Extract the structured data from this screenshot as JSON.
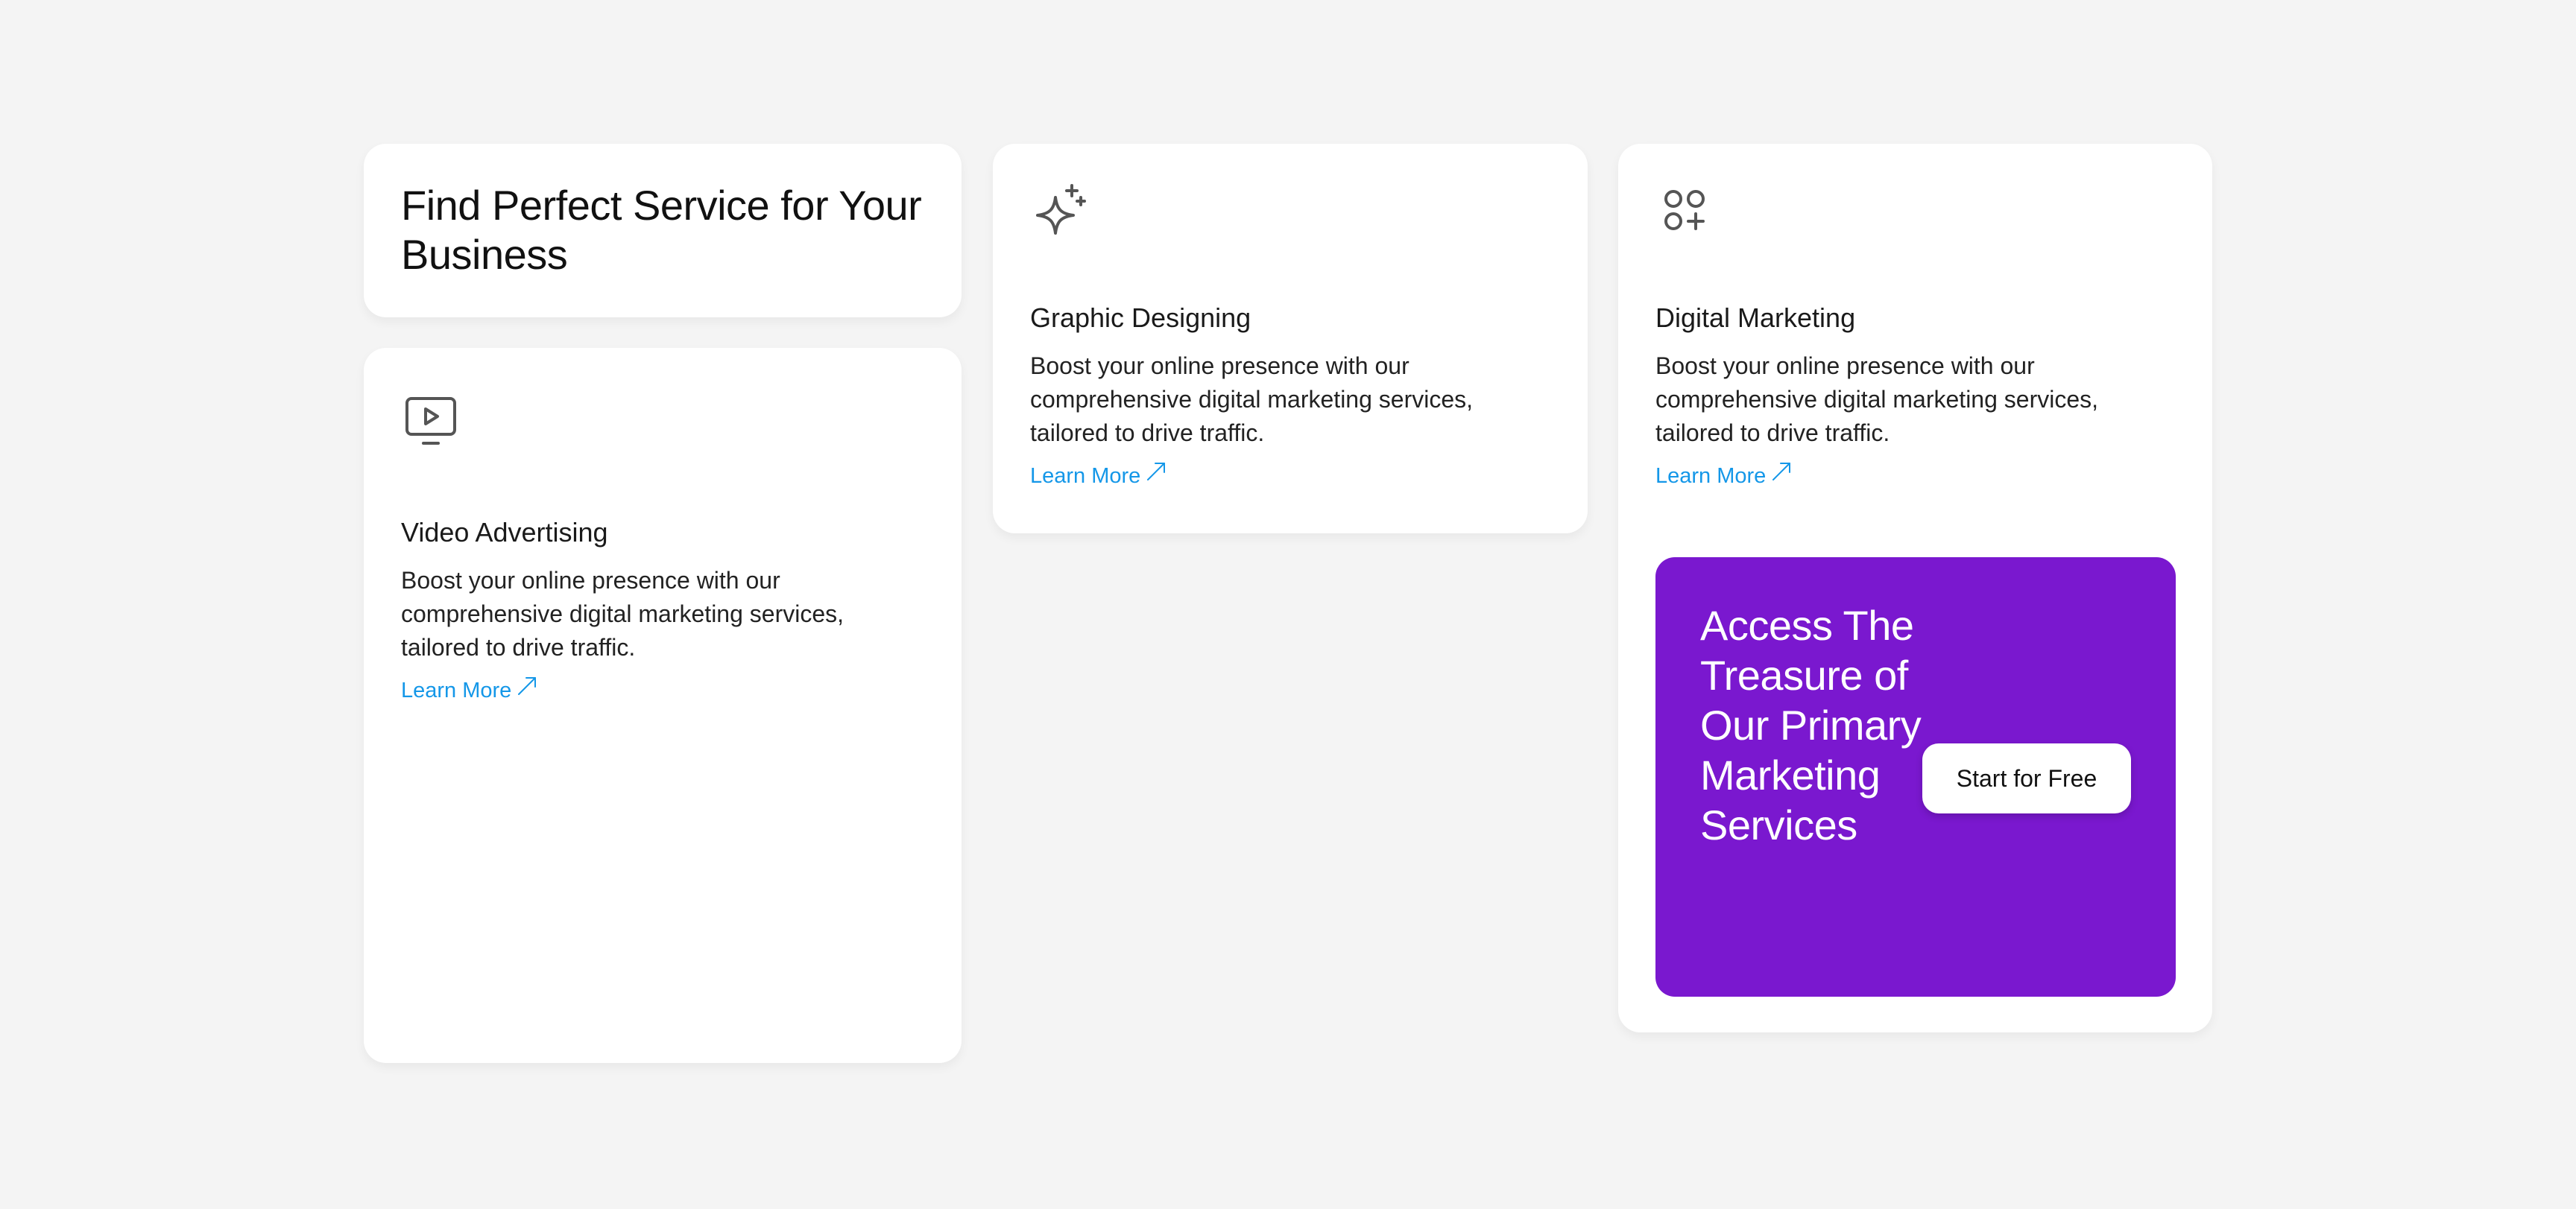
{
  "heading": {
    "title": "Find Perfect Service for Your Business"
  },
  "services": [
    {
      "icon": "tv-play-icon",
      "title": "Video Advertising",
      "description": "Boost your online presence with our comprehensive digital marketing services, tailored to drive traffic.",
      "link_label": "Learn More"
    },
    {
      "icon": "sparkles-icon",
      "title": "Graphic Designing",
      "description": "Boost your online presence with our comprehensive digital marketing services, tailored to drive traffic.",
      "link_label": "Learn More"
    },
    {
      "icon": "circles-plus-icon",
      "title": "Digital Marketing",
      "description": "Boost your online presence with our comprehensive digital marketing services, tailored to drive traffic.",
      "link_label": "Learn More"
    }
  ],
  "promo": {
    "title": "Access The Treasure of Our Primary Marketing Services",
    "cta_label": "Start for Free"
  },
  "colors": {
    "page_bg": "#f4f4f4",
    "card_bg": "#ffffff",
    "link": "#1497e8",
    "promo_bg": "#7a18cf",
    "icon": "#555555"
  }
}
